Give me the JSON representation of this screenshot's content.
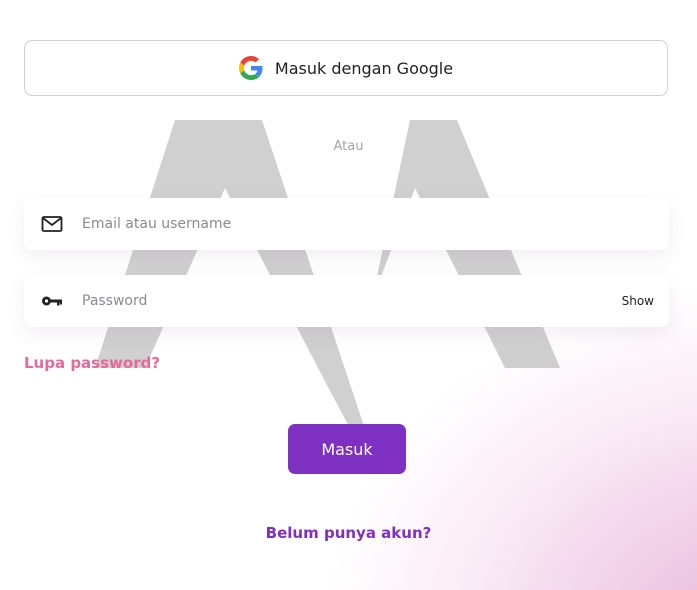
{
  "google_button": {
    "label": "Masuk dengan Google",
    "icon": "google-icon"
  },
  "divider": {
    "text": "Atau"
  },
  "email_field": {
    "placeholder": "Email atau username",
    "value": "",
    "icon": "mail-icon"
  },
  "password_field": {
    "placeholder": "Password",
    "value": "",
    "icon": "key-icon",
    "toggle_label": "Show"
  },
  "forgot_link": {
    "label": "Lupa password?"
  },
  "submit_button": {
    "label": "Masuk"
  },
  "signup_link": {
    "label": "Belum punya akun?"
  },
  "colors": {
    "primary": "#7e30c2",
    "link_pink": "#e46a9a",
    "background_accent": "#e6b5da",
    "watermark": "#c8c8c8"
  }
}
